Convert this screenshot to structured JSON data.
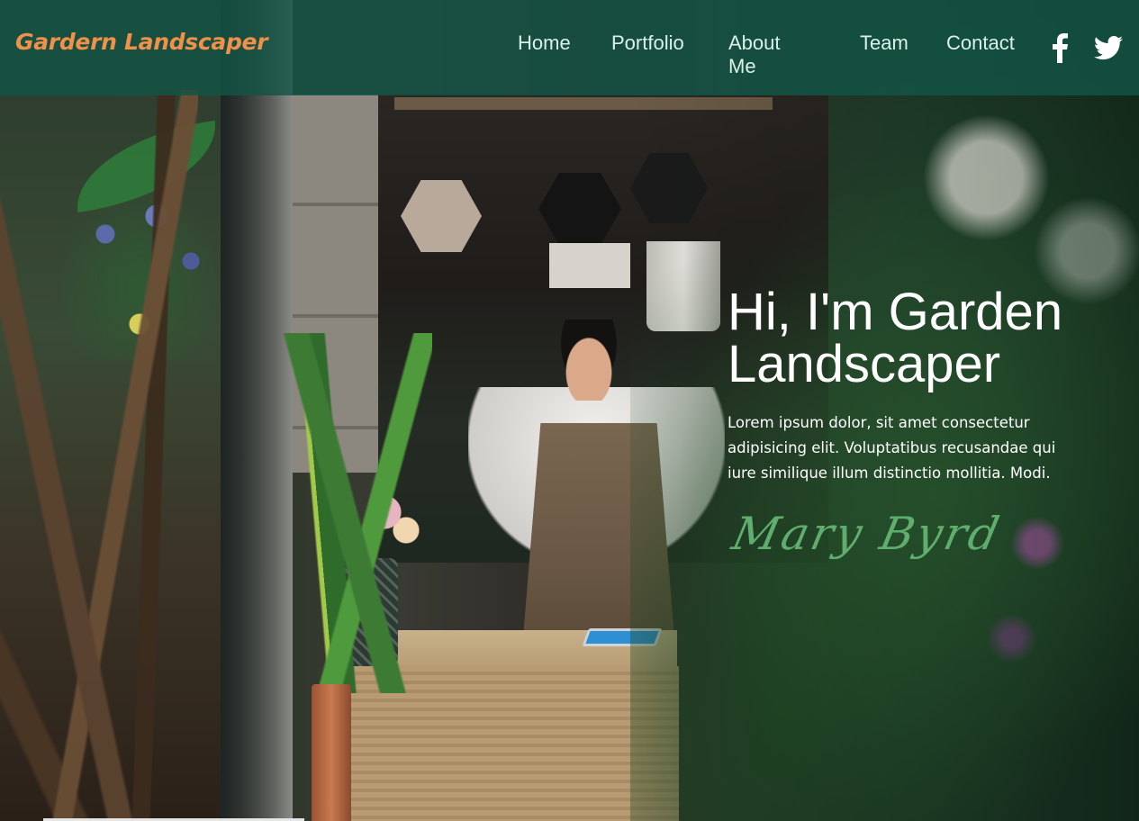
{
  "brand": {
    "name": "Gardern Landscaper",
    "color": "#f0914a"
  },
  "nav": {
    "items": [
      {
        "label": "Home"
      },
      {
        "label": "Portfolio"
      },
      {
        "label": "About Me"
      },
      {
        "label": "Team"
      },
      {
        "label": "Contact"
      }
    ],
    "social": [
      {
        "icon": "facebook-icon"
      },
      {
        "icon": "twitter-icon"
      }
    ],
    "background": "#125446"
  },
  "hero": {
    "title": "Hi, I'm Garden Landscaper",
    "text": "Lorem ipsum dolor, sit amet consectetur adipisicing elit. Voluptatibus recusandae qui iure similique illum distinctio mollitia. Modi.",
    "signature": "Mary Byrd",
    "signature_color": "#5fae6e"
  }
}
